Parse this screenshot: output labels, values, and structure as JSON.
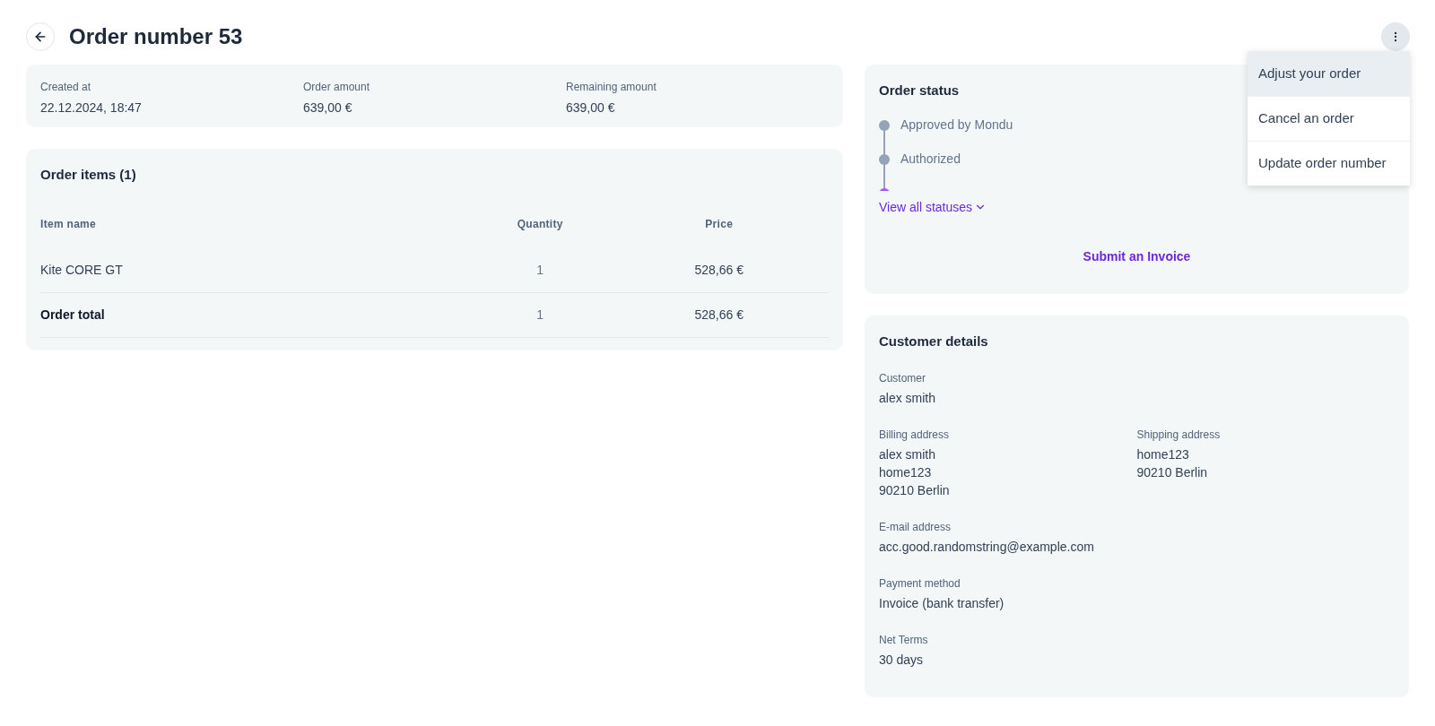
{
  "header": {
    "title": "Order number 53"
  },
  "summary": [
    {
      "label": "Created at",
      "value": "22.12.2024, 18:47"
    },
    {
      "label": "Order amount",
      "value": "639,00 €"
    },
    {
      "label": "Remaining amount",
      "value": "639,00 €"
    }
  ],
  "order_items": {
    "title": "Order items (1)",
    "columns": [
      "Item name",
      "Quantity",
      "Price"
    ],
    "rows": [
      {
        "kind": "item",
        "cells": [
          "Kite CORE GT",
          "1",
          "528,66 €"
        ]
      },
      {
        "kind": "total",
        "cells": [
          "Order total",
          "1",
          "528,66 €"
        ]
      }
    ]
  },
  "order_status": {
    "title": "Order status",
    "statuses": [
      {
        "label": "Approved by Mondu",
        "color": "#94a3b8"
      },
      {
        "label": "Authorized",
        "color": "#94a3b8"
      },
      {
        "color": "#a855f7"
      }
    ],
    "view_all": "View all statuses",
    "submit": "Submit an Invoice"
  },
  "menu": [
    {
      "label": "Adjust your order",
      "selected": true
    },
    {
      "label": "Cancel an order",
      "selected": false
    },
    {
      "label": "Update order number",
      "selected": false
    }
  ],
  "customer_details": {
    "title": "Customer details",
    "customer": {
      "label": "Customer",
      "lines": [
        "alex smith"
      ]
    },
    "billing": {
      "label": "Billing address",
      "lines": [
        "alex smith",
        "home123",
        "90210 Berlin"
      ]
    },
    "shipping": {
      "label": "Shipping address",
      "lines": [
        "home123",
        "90210 Berlin"
      ]
    },
    "fields": [
      {
        "label": "E-mail address",
        "lines": [
          "acc.good.randomstring@example.com"
        ]
      },
      {
        "label": "Payment method",
        "lines": [
          "Invoice (bank transfer)"
        ]
      },
      {
        "label": "Net Terms",
        "lines": [
          "30 days"
        ]
      }
    ]
  }
}
